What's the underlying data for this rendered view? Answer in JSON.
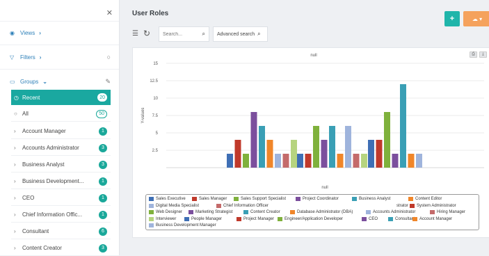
{
  "sidebar": {
    "views_label": "Views",
    "filters_label": "Filters",
    "groups_label": "Groups",
    "groups": [
      {
        "label": "Recent",
        "count": "20",
        "icon": "clock-icon",
        "active": true
      },
      {
        "label": "All",
        "count": "50",
        "icon": "circle-icon"
      },
      {
        "label": "Account Manager",
        "count": "1",
        "icon": "chevron-right-icon"
      },
      {
        "label": "Accounts Administrator",
        "count": "3",
        "icon": "chevron-right-icon"
      },
      {
        "label": "Business Analyst",
        "count": "3",
        "icon": "chevron-right-icon"
      },
      {
        "label": "Business Development...",
        "count": "1",
        "icon": "chevron-right-icon"
      },
      {
        "label": "CEO",
        "count": "1",
        "icon": "chevron-right-icon"
      },
      {
        "label": "Chief Information Offic...",
        "count": "1",
        "icon": "chevron-right-icon"
      },
      {
        "label": "Consultant",
        "count": "6",
        "icon": "chevron-right-icon"
      },
      {
        "label": "Content Creator",
        "count": "3",
        "icon": "chevron-right-icon"
      }
    ]
  },
  "header": {
    "title": "User Roles",
    "add_button": "+",
    "search_placeholder": "Search...",
    "advanced_search": "Advanced search"
  },
  "chart_data": {
    "type": "bar",
    "title": "null",
    "xlabel": "null",
    "ylabel": "Y-values",
    "ylim": [
      0,
      15
    ],
    "yticks": [
      "15",
      "12.5",
      "10",
      "7.5",
      "5",
      "2.5"
    ],
    "grid": true,
    "legend_position": "bottom",
    "series": [
      {
        "name": "Sales Executive",
        "color": "#3f6fb5",
        "values": [
          2,
          2,
          4
        ]
      },
      {
        "name": "Sales Manager",
        "color": "#c0392b",
        "values": [
          4,
          2,
          4
        ]
      },
      {
        "name": "Sales Support Specialist",
        "color": "#7fb13c",
        "values": [
          2,
          6,
          8
        ]
      },
      {
        "name": "Project Coordinator",
        "color": "#7b4f9d",
        "values": [
          8,
          4,
          2
        ]
      },
      {
        "name": "Business Analyst",
        "color": "#3a9fb5",
        "values": [
          6,
          6,
          12
        ]
      },
      {
        "name": "Content Editor",
        "color": "#f0862a",
        "values": [
          4,
          2,
          2
        ]
      },
      {
        "name": "Digital Media Specialist",
        "color": "#9fb4dc",
        "values": [
          2,
          6,
          2
        ]
      },
      {
        "name": "Chief Information Officer",
        "color": "#c46a6a",
        "values": [
          2,
          2,
          null
        ]
      },
      {
        "name": "strator",
        "color": "#b6d47f",
        "values": [
          4,
          2,
          null
        ]
      }
    ],
    "legend": [
      {
        "name": "Sales Executive",
        "color": "#3f6fb5"
      },
      {
        "name": "Sales Manager",
        "color": "#c0392b"
      },
      {
        "name": "Sales Support Specialist",
        "color": "#7fb13c"
      },
      {
        "name": "Project Coordinator",
        "color": "#7b4f9d"
      },
      {
        "name": "Business Analyst",
        "color": "#3a9fb5"
      },
      {
        "name": "Content Editor",
        "color": "#f0862a"
      },
      {
        "name": "Digital Media Specialist",
        "color": "#9fb4dc"
      },
      {
        "name": "Chief Information Officer",
        "color": "#c46a6a"
      },
      {
        "name": "strator",
        "color": "#ffffff"
      },
      {
        "name": "System Administrator",
        "color": "#c0392b"
      },
      {
        "name": "Web Designer",
        "color": "#7fb13c"
      },
      {
        "name": "Marketing Strategist",
        "color": "#7b4f9d"
      },
      {
        "name": "Content Creator",
        "color": "#3a9fb5"
      },
      {
        "name": "Database Administrator (DBA)",
        "color": "#f0862a"
      },
      {
        "name": "Accounts Administrator",
        "color": "#9fb4dc"
      },
      {
        "name": "Hiring Manager",
        "color": "#c46a6a"
      },
      {
        "name": "Interviewer",
        "color": "#b6d47f"
      },
      {
        "name": "People Manager",
        "color": "#3f6fb5"
      },
      {
        "name": "Project Manager",
        "color": "#c0392b"
      },
      {
        "name": "Engineer/Application Developer",
        "color": "#7fb13c"
      },
      {
        "name": "CEO",
        "color": "#7b4f9d"
      },
      {
        "name": "Consultant",
        "color": "#3a9fb5"
      },
      {
        "name": "Account Manager",
        "color": "#f0862a"
      },
      {
        "name": "Business Development Manager",
        "color": "#9fb4dc"
      }
    ]
  },
  "colors": {
    "accent": "#1aa8a0",
    "export": "#f5a25d",
    "link": "#2c7fb8"
  }
}
